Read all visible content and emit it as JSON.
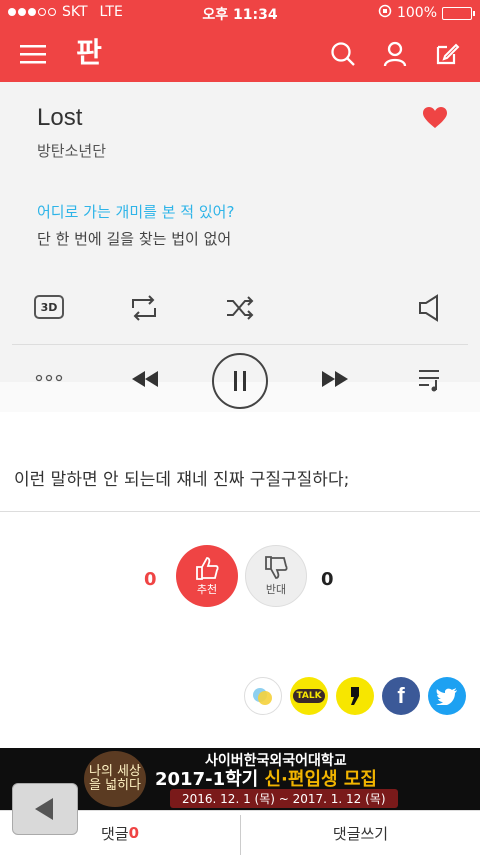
{
  "status": {
    "carrier": "SKT",
    "network": "LTE",
    "time": "오후 11:34",
    "battery": "100%"
  },
  "nav": {
    "logo": "판"
  },
  "player": {
    "title": "Lost",
    "artist": "방탄소년단",
    "lyric_highlight": "어디로 가는 개미를 본 적 있어?",
    "lyric_next": "단 한 번에 길을 찾는 법이 없어",
    "three_d_label": "3D"
  },
  "comment_text": "이런 말하면 안 되는데 쟤네 진짜 구질구질하다;",
  "votes": {
    "up_count": "0",
    "up_label": "추천",
    "down_label": "반대",
    "down_count": "0"
  },
  "share": {
    "kakao_talk": "TALK"
  },
  "banner": {
    "line1": "사이버한국외국어대학교",
    "line2_a": "2017-1학기 ",
    "line2_b": "신·편입생 모집",
    "line3": "2016. 12. 1 (목) ~ 2017. 1. 12 (목)",
    "badge": "나의 세상을 넓히다"
  },
  "bottom": {
    "comment_label": "댓글",
    "comment_count": "0",
    "write_label": "댓글쓰기"
  },
  "colors": {
    "accent": "#ef4444",
    "lyric": "#2eb4e8"
  }
}
